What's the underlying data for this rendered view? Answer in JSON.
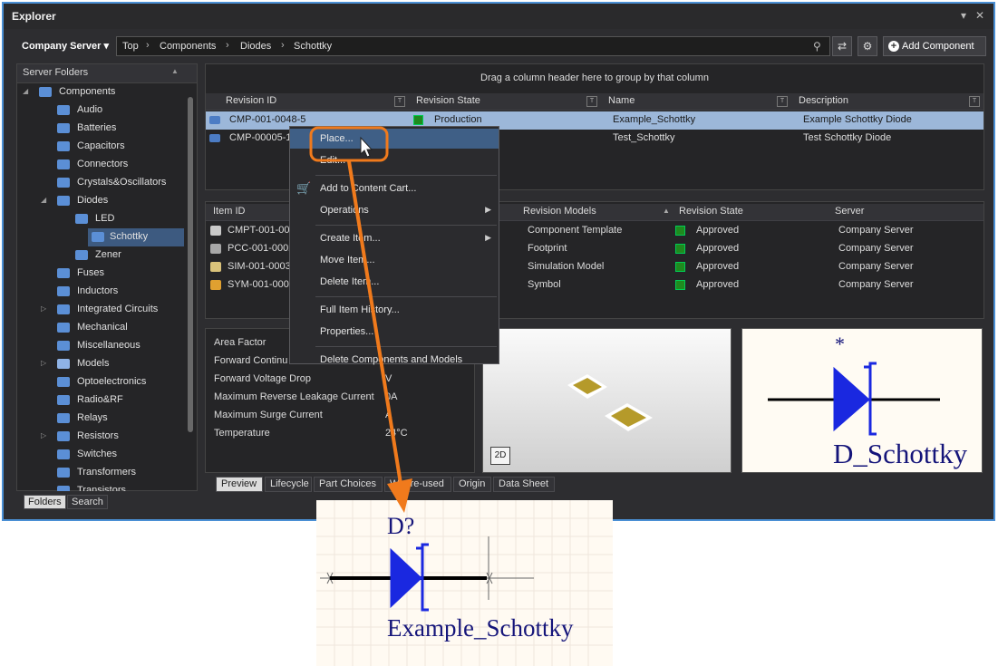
{
  "window": {
    "title": "Explorer",
    "pin_icon": "pin-icon",
    "close_icon": "close-icon"
  },
  "toolbar": {
    "server": "Company Server",
    "breadcrumb": [
      "Top",
      "Components",
      "Diodes",
      "Schottky"
    ],
    "add_component": "Add Component"
  },
  "tree": {
    "header": "Server Folders",
    "items": [
      {
        "label": "Components",
        "level": 0,
        "expand": "open"
      },
      {
        "label": "Audio",
        "level": 1
      },
      {
        "label": "Batteries",
        "level": 1
      },
      {
        "label": "Capacitors",
        "level": 1
      },
      {
        "label": "Connectors",
        "level": 1
      },
      {
        "label": "Crystals&Oscillators",
        "level": 1
      },
      {
        "label": "Diodes",
        "level": 1,
        "expand": "open"
      },
      {
        "label": "LED",
        "level": 2
      },
      {
        "label": "Schottky",
        "level": 2,
        "selected": true
      },
      {
        "label": "Zener",
        "level": 2
      },
      {
        "label": "Fuses",
        "level": 1
      },
      {
        "label": "Inductors",
        "level": 1
      },
      {
        "label": "Integrated Circuits",
        "level": 1,
        "expand": "closed"
      },
      {
        "label": "Mechanical",
        "level": 1
      },
      {
        "label": "Miscellaneous",
        "level": 1
      },
      {
        "label": "Models",
        "level": 1,
        "expand": "closed",
        "folder": true
      },
      {
        "label": "Optoelectronics",
        "level": 1
      },
      {
        "label": "Radio&RF",
        "level": 1
      },
      {
        "label": "Relays",
        "level": 1
      },
      {
        "label": "Resistors",
        "level": 1,
        "expand": "closed"
      },
      {
        "label": "Switches",
        "level": 1
      },
      {
        "label": "Transformers",
        "level": 1
      },
      {
        "label": "Transistors",
        "level": 1
      }
    ],
    "tabs": [
      "Folders",
      "Search"
    ]
  },
  "grid": {
    "group_hint": "Drag a column header here to group by that column",
    "columns": [
      "Revision ID",
      "Revision State",
      "Name",
      "Description"
    ],
    "rows": [
      {
        "id": "CMP-001-0048-5",
        "state": "Production",
        "name": "Example_Schottky",
        "desc": "Example Schottky Diode",
        "selected": true
      },
      {
        "id": "CMP-00005-1",
        "state": "",
        "name": "Test_Schottky",
        "desc": "Test Schottky Diode"
      }
    ]
  },
  "models": {
    "columns": [
      "Item ID",
      "Revision Models",
      "Revision State",
      "Server"
    ],
    "rows": [
      {
        "id": "CMPT-001-000",
        "model": "Component Template",
        "state": "Approved",
        "server": "Company Server"
      },
      {
        "id": "PCC-001-0002",
        "model": "Footprint",
        "state": "Approved",
        "server": "Company Server"
      },
      {
        "id": "SIM-001-0003",
        "model": "Simulation Model",
        "state": "Approved",
        "server": "Company Server"
      },
      {
        "id": "SYM-001-0002",
        "model": "Symbol",
        "state": "Approved",
        "server": "Company Server"
      }
    ]
  },
  "params": {
    "rows": [
      {
        "name": "Area Factor",
        "value": ""
      },
      {
        "name": "Forward Continu",
        "value": ""
      },
      {
        "name": "Forward Voltage Drop",
        "value": "V"
      },
      {
        "name": "Maximum Reverse Leakage Current",
        "value": "0A"
      },
      {
        "name": "Maximum Surge Current",
        "value": "A"
      },
      {
        "name": "Temperature",
        "value": "24°C"
      }
    ]
  },
  "bottom_tabs": [
    "Preview",
    "Lifecycle",
    "Part Choices",
    "Where-used",
    "Origin",
    "Data Sheet"
  ],
  "context_menu": [
    {
      "label": "Place...",
      "highlight": true
    },
    {
      "label": "Edit..."
    },
    {
      "sep": true
    },
    {
      "label": "Add to Content Cart...",
      "icon": "cart-icon"
    },
    {
      "label": "Operations",
      "submenu": true
    },
    {
      "sep": true
    },
    {
      "label": "Create Item...",
      "submenu": true
    },
    {
      "label": "Move Item..."
    },
    {
      "label": "Delete Item..."
    },
    {
      "sep": true
    },
    {
      "label": "Full Item History..."
    },
    {
      "label": "Properties..."
    },
    {
      "sep": true
    },
    {
      "label": "Delete Components and Models"
    }
  ],
  "preview": {
    "badge_2d": "2D"
  },
  "symbol": {
    "star": "*",
    "label": "D_Schottky"
  },
  "placed": {
    "designator": "D?",
    "comment": "Example_Schottky"
  },
  "colors": {
    "accent_border": "#4a8fd4",
    "callout": "#f07a1c",
    "diode": "#1a28e0"
  }
}
